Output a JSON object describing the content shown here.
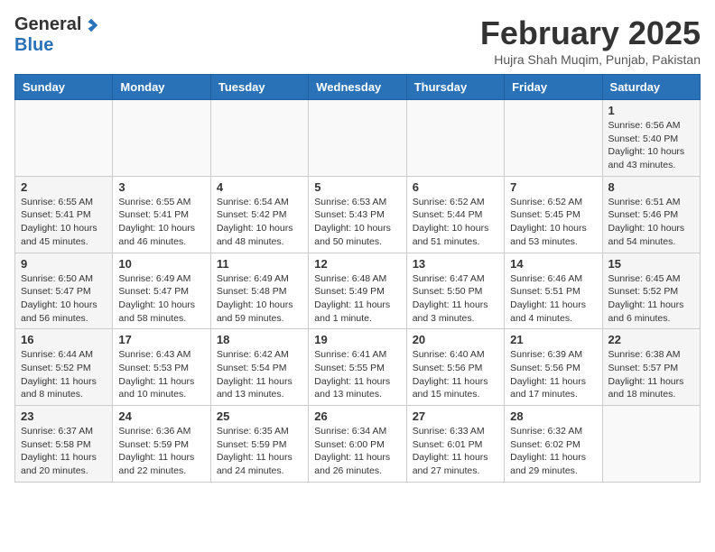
{
  "header": {
    "logo_general": "General",
    "logo_blue": "Blue",
    "month_year": "February 2025",
    "location": "Hujra Shah Muqim, Punjab, Pakistan"
  },
  "days_of_week": [
    "Sunday",
    "Monday",
    "Tuesday",
    "Wednesday",
    "Thursday",
    "Friday",
    "Saturday"
  ],
  "weeks": [
    [
      {
        "day": "",
        "info": ""
      },
      {
        "day": "",
        "info": ""
      },
      {
        "day": "",
        "info": ""
      },
      {
        "day": "",
        "info": ""
      },
      {
        "day": "",
        "info": ""
      },
      {
        "day": "",
        "info": ""
      },
      {
        "day": "1",
        "info": "Sunrise: 6:56 AM\nSunset: 5:40 PM\nDaylight: 10 hours and 43 minutes."
      }
    ],
    [
      {
        "day": "2",
        "info": "Sunrise: 6:55 AM\nSunset: 5:41 PM\nDaylight: 10 hours and 45 minutes."
      },
      {
        "day": "3",
        "info": "Sunrise: 6:55 AM\nSunset: 5:41 PM\nDaylight: 10 hours and 46 minutes."
      },
      {
        "day": "4",
        "info": "Sunrise: 6:54 AM\nSunset: 5:42 PM\nDaylight: 10 hours and 48 minutes."
      },
      {
        "day": "5",
        "info": "Sunrise: 6:53 AM\nSunset: 5:43 PM\nDaylight: 10 hours and 50 minutes."
      },
      {
        "day": "6",
        "info": "Sunrise: 6:52 AM\nSunset: 5:44 PM\nDaylight: 10 hours and 51 minutes."
      },
      {
        "day": "7",
        "info": "Sunrise: 6:52 AM\nSunset: 5:45 PM\nDaylight: 10 hours and 53 minutes."
      },
      {
        "day": "8",
        "info": "Sunrise: 6:51 AM\nSunset: 5:46 PM\nDaylight: 10 hours and 54 minutes."
      }
    ],
    [
      {
        "day": "9",
        "info": "Sunrise: 6:50 AM\nSunset: 5:47 PM\nDaylight: 10 hours and 56 minutes."
      },
      {
        "day": "10",
        "info": "Sunrise: 6:49 AM\nSunset: 5:47 PM\nDaylight: 10 hours and 58 minutes."
      },
      {
        "day": "11",
        "info": "Sunrise: 6:49 AM\nSunset: 5:48 PM\nDaylight: 10 hours and 59 minutes."
      },
      {
        "day": "12",
        "info": "Sunrise: 6:48 AM\nSunset: 5:49 PM\nDaylight: 11 hours and 1 minute."
      },
      {
        "day": "13",
        "info": "Sunrise: 6:47 AM\nSunset: 5:50 PM\nDaylight: 11 hours and 3 minutes."
      },
      {
        "day": "14",
        "info": "Sunrise: 6:46 AM\nSunset: 5:51 PM\nDaylight: 11 hours and 4 minutes."
      },
      {
        "day": "15",
        "info": "Sunrise: 6:45 AM\nSunset: 5:52 PM\nDaylight: 11 hours and 6 minutes."
      }
    ],
    [
      {
        "day": "16",
        "info": "Sunrise: 6:44 AM\nSunset: 5:52 PM\nDaylight: 11 hours and 8 minutes."
      },
      {
        "day": "17",
        "info": "Sunrise: 6:43 AM\nSunset: 5:53 PM\nDaylight: 11 hours and 10 minutes."
      },
      {
        "day": "18",
        "info": "Sunrise: 6:42 AM\nSunset: 5:54 PM\nDaylight: 11 hours and 13 minutes."
      },
      {
        "day": "19",
        "info": "Sunrise: 6:41 AM\nSunset: 5:55 PM\nDaylight: 11 hours and 13 minutes."
      },
      {
        "day": "20",
        "info": "Sunrise: 6:40 AM\nSunset: 5:56 PM\nDaylight: 11 hours and 15 minutes."
      },
      {
        "day": "21",
        "info": "Sunrise: 6:39 AM\nSunset: 5:56 PM\nDaylight: 11 hours and 17 minutes."
      },
      {
        "day": "22",
        "info": "Sunrise: 6:38 AM\nSunset: 5:57 PM\nDaylight: 11 hours and 18 minutes."
      }
    ],
    [
      {
        "day": "23",
        "info": "Sunrise: 6:37 AM\nSunset: 5:58 PM\nDaylight: 11 hours and 20 minutes."
      },
      {
        "day": "24",
        "info": "Sunrise: 6:36 AM\nSunset: 5:59 PM\nDaylight: 11 hours and 22 minutes."
      },
      {
        "day": "25",
        "info": "Sunrise: 6:35 AM\nSunset: 5:59 PM\nDaylight: 11 hours and 24 minutes."
      },
      {
        "day": "26",
        "info": "Sunrise: 6:34 AM\nSunset: 6:00 PM\nDaylight: 11 hours and 26 minutes."
      },
      {
        "day": "27",
        "info": "Sunrise: 6:33 AM\nSunset: 6:01 PM\nDaylight: 11 hours and 27 minutes."
      },
      {
        "day": "28",
        "info": "Sunrise: 6:32 AM\nSunset: 6:02 PM\nDaylight: 11 hours and 29 minutes."
      },
      {
        "day": "",
        "info": ""
      }
    ]
  ]
}
